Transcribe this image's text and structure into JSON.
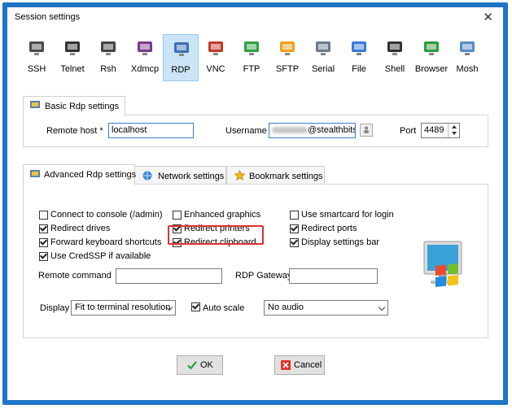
{
  "window": {
    "title": "Session settings"
  },
  "protocols": [
    {
      "label": "SSH",
      "icon": "ssh-icon",
      "color": "#4a4a4a"
    },
    {
      "label": "Telnet",
      "icon": "telnet-icon",
      "color": "#333333"
    },
    {
      "label": "Rsh",
      "icon": "rsh-icon",
      "color": "#444444"
    },
    {
      "label": "Xdmcp",
      "icon": "xdmcp-icon",
      "color": "#7a3a8a"
    },
    {
      "label": "RDP",
      "icon": "rdp-icon",
      "color": "#3b6fb6"
    },
    {
      "label": "VNC",
      "icon": "vnc-icon",
      "color": "#c0392b"
    },
    {
      "label": "FTP",
      "icon": "ftp-icon",
      "color": "#2ea043"
    },
    {
      "label": "SFTP",
      "icon": "sftp-icon",
      "color": "#f0a020"
    },
    {
      "label": "Serial",
      "icon": "serial-icon",
      "color": "#6a7a8a"
    },
    {
      "label": "File",
      "icon": "file-icon",
      "color": "#3a7bd5"
    },
    {
      "label": "Shell",
      "icon": "shell-icon",
      "color": "#333333"
    },
    {
      "label": "Browser",
      "icon": "browser-icon",
      "color": "#2e9c3a"
    },
    {
      "label": "Mosh",
      "icon": "mosh-icon",
      "color": "#5a8ac6"
    }
  ],
  "selected_protocol": "RDP",
  "basic": {
    "tab_label": "Basic Rdp settings",
    "remote_host_label": "Remote host *",
    "remote_host_value": "localhost",
    "username_label": "Username",
    "username_value": "@stealthbits",
    "port_label": "Port",
    "port_value": "4489"
  },
  "tabs": [
    {
      "label": "Advanced Rdp settings",
      "icon": "rdp-icon"
    },
    {
      "label": "Network settings",
      "icon": "globe-icon"
    },
    {
      "label": "Bookmark settings",
      "icon": "star-icon"
    }
  ],
  "advanced": {
    "checkboxes": [
      {
        "label": "Connect to console (/admin)",
        "checked": false
      },
      {
        "label": "Enhanced graphics",
        "checked": false
      },
      {
        "label": "Use smartcard for login",
        "checked": false
      },
      {
        "label": "Redirect drives",
        "checked": true
      },
      {
        "label": "Redirect printers",
        "checked": true
      },
      {
        "label": "Redirect ports",
        "checked": true
      },
      {
        "label": "Forward keyboard shortcuts",
        "checked": true
      },
      {
        "label": "Redirect clipboard",
        "checked": true
      },
      {
        "label": "Display settings bar",
        "checked": true
      },
      {
        "label": "Use CredSSP if available",
        "checked": true
      }
    ],
    "remote_command_label": "Remote command",
    "remote_command_value": "",
    "rdp_gateway_label": "RDP Gateway",
    "rdp_gateway_value": "",
    "display_label": "Display",
    "display_value": "Fit to terminal resolution",
    "auto_scale_label": "Auto scale",
    "auto_scale_checked": true,
    "audio_value": "No audio",
    "highlight_color": "#e03030"
  },
  "buttons": {
    "ok": "OK",
    "cancel": "Cancel"
  }
}
